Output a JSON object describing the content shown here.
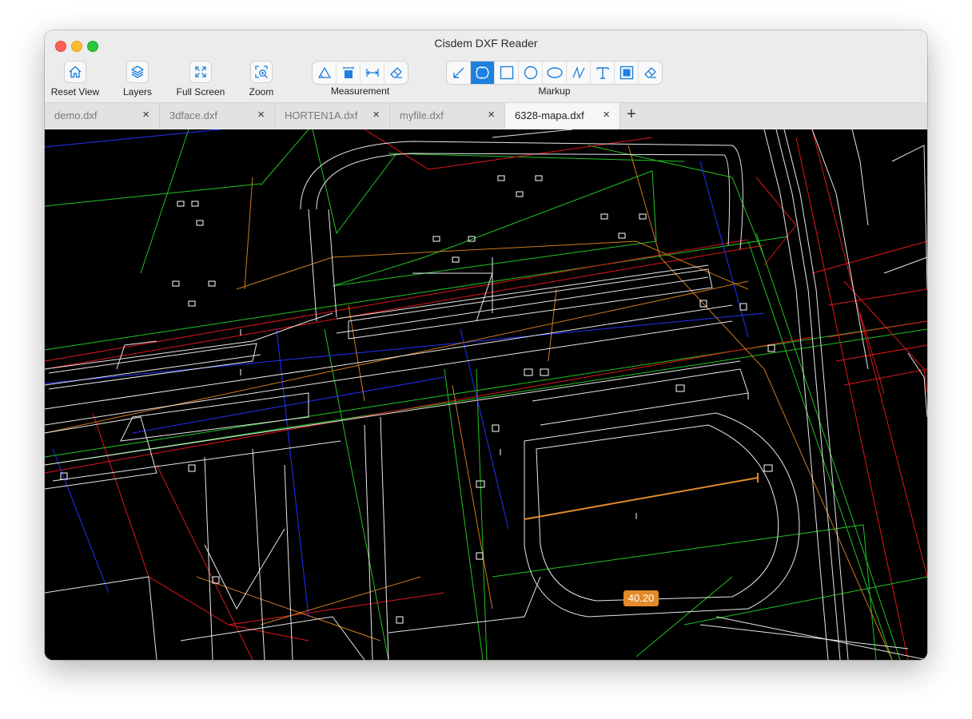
{
  "window": {
    "title": "Cisdem DXF Reader"
  },
  "toolbar": {
    "reset_view": "Reset View",
    "layers": "Layers",
    "full_screen": "Full Screen",
    "zoom": "Zoom",
    "measurement_label": "Measurement",
    "markup_label": "Markup",
    "measurement_tools": [
      "angle-measure-icon",
      "area-measure-icon",
      "distance-measure-icon",
      "eraser-icon"
    ],
    "markup_tools": [
      "arrow-icon",
      "cloud-select-icon",
      "rectangle-icon",
      "circle-icon",
      "ellipse-icon",
      "freehand-icon",
      "text-icon",
      "filled-rect-icon",
      "eraser-icon"
    ],
    "active_markup_tool": "cloud-select-icon"
  },
  "tabs": [
    {
      "label": "demo.dxf",
      "active": false
    },
    {
      "label": "3dface.dxf",
      "active": false
    },
    {
      "label": "HORTEN1A.dxf",
      "active": false
    },
    {
      "label": "myfile.dxf",
      "active": false
    },
    {
      "label": "6328-mapa.dxf",
      "active": true
    }
  ],
  "tab_close_glyph": "×",
  "new_tab_glyph": "+",
  "drawing": {
    "measurement_value": "40.20",
    "colors": {
      "background": "#000000",
      "white": "#ffffff",
      "green": "#22c322",
      "red": "#e0161a",
      "blue": "#2233ff",
      "orange": "#d07a1e",
      "measure": "#e28a2a"
    }
  }
}
